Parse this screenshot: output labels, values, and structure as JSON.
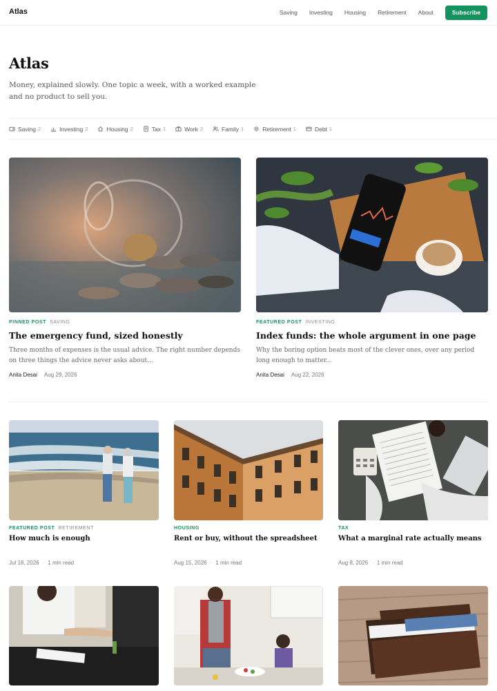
{
  "header": {
    "brand": "Atlas",
    "nav": [
      "Saving",
      "Investing",
      "Housing",
      "Retirement",
      "About"
    ],
    "subscribe_label": "Subscribe"
  },
  "hero": {
    "title": "Atlas",
    "description": "Money, explained slowly. One topic a week, with a worked example and no product to sell you."
  },
  "topics": [
    {
      "label": "Saving",
      "count": "2",
      "icon": "wallet-icon"
    },
    {
      "label": "Investing",
      "count": "2",
      "icon": "bar-chart-icon"
    },
    {
      "label": "Housing",
      "count": "2",
      "icon": "home-icon"
    },
    {
      "label": "Tax",
      "count": "1",
      "icon": "receipt-icon"
    },
    {
      "label": "Work",
      "count": "2",
      "icon": "briefcase-icon"
    },
    {
      "label": "Family",
      "count": "1",
      "icon": "people-icon"
    },
    {
      "label": "Retirement",
      "count": "1",
      "icon": "sun-icon"
    },
    {
      "label": "Debt",
      "count": "1",
      "icon": "credit-card-icon"
    }
  ],
  "featured": [
    {
      "label": "PINNED POST",
      "category": "SAVING",
      "title": "The emergency fund, sized honestly",
      "excerpt": "Three months of expenses is the usual advice. The right number depends on three things the advice never asks about...",
      "author": "Anita Desai",
      "date": "Aug 29, 2026",
      "image": "coins spilling from a glass jar"
    },
    {
      "label": "FEATURED POST",
      "category": "INVESTING",
      "title": "Index funds: the whole argument in one page",
      "excerpt": "Why the boring option beats most of the clever ones, over any period long enough to matter...",
      "author": "Anita Desai",
      "date": "Aug 22, 2026",
      "image": "phone showing stock chart next to coffee"
    }
  ],
  "grid": [
    {
      "label": "FEATURED POST",
      "category": "RETIREMENT",
      "title": "How much is enough",
      "date": "Jul 18, 2026",
      "read": "1 min read",
      "image": "older couple walking on a beach"
    },
    {
      "label": "HOUSING",
      "category": "",
      "title": "Rent or buy, without the spreadsheet",
      "date": "Aug 15, 2026",
      "read": "1 min read",
      "image": "apartment building facade"
    },
    {
      "label": "TAX",
      "category": "",
      "title": "What a marginal rate actually means",
      "date": "Aug 8, 2026",
      "read": "1 min read",
      "image": "tax form with calculator"
    }
  ],
  "grid2_images": [
    "business handshake over a desk",
    "mother and daughter cooking in a kitchen",
    "leather wallet on wooden table"
  ],
  "colors": {
    "accent": "#14935e"
  }
}
